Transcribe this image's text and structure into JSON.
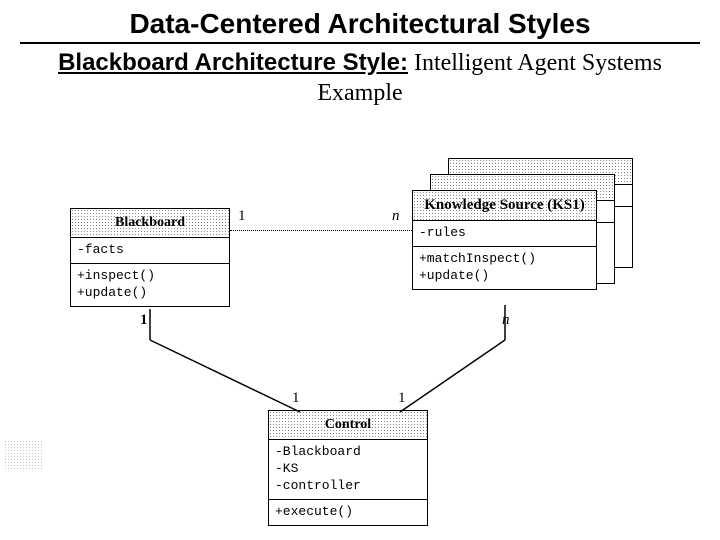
{
  "title": "Data-Centered Architectural Styles",
  "subtitle_bold": "Blackboard Architecture Style:",
  "subtitle_rest": " Intelligent Agent Systems Example",
  "classes": {
    "blackboard": {
      "name": "Blackboard",
      "attributes": "-facts",
      "operations": "+inspect()\n+update()"
    },
    "ks": {
      "name": "Knowledge Source (KS1)",
      "attributes": "-rules",
      "operations": "+matchInspect()\n+update()"
    },
    "control": {
      "name": "Control",
      "attributes": "-Blackboard\n-KS\n-controller",
      "operations": "+execute()"
    }
  },
  "multiplicities": {
    "bb_ks_left": "1",
    "bb_ks_right": "n",
    "bb_ctrl_top": "1",
    "ks_ctrl_top": "n",
    "ctrl_left": "1",
    "ctrl_right": "1"
  }
}
